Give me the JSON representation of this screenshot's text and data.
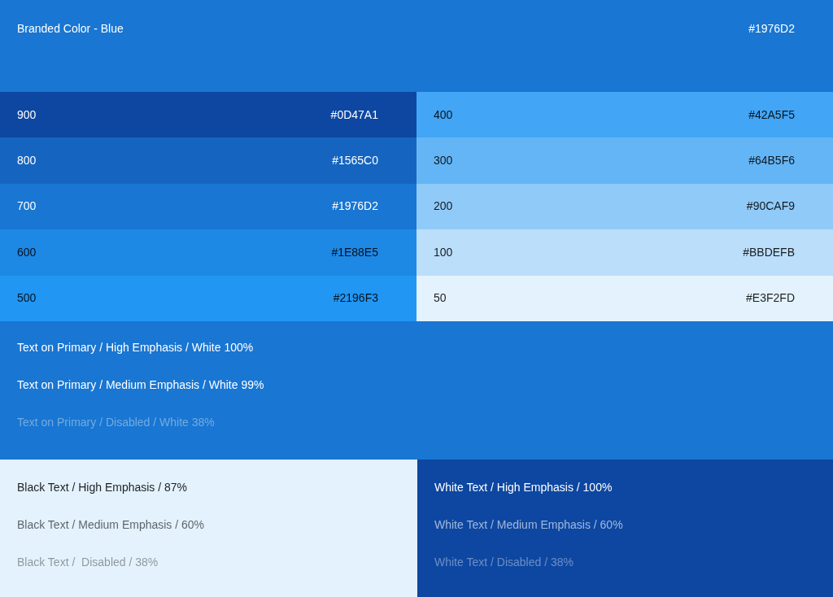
{
  "header": {
    "title": "Branded Color - Blue",
    "hex": "#1976D2",
    "color": "#1976d2"
  },
  "swatches": [
    {
      "shade": "900",
      "hex": "#0D47A1",
      "color": "#0d47a1",
      "kind": "light"
    },
    {
      "shade": "800",
      "hex": "#1565C0",
      "color": "#1565c0",
      "kind": "light"
    },
    {
      "shade": "700",
      "hex": "#1976D2",
      "color": "#1976d2",
      "kind": "light"
    },
    {
      "shade": "600",
      "hex": "#1E88E5",
      "color": "#1e88e5",
      "kind": "dark"
    },
    {
      "shade": "500",
      "hex": "#2196F3",
      "color": "#2196f3",
      "kind": "dark"
    },
    {
      "shade": "400",
      "hex": "#42A5F5",
      "color": "#42a5f5",
      "kind": "dark"
    },
    {
      "shade": "300",
      "hex": "#64B5F6",
      "color": "#64b5f6",
      "kind": "dark"
    },
    {
      "shade": "200",
      "hex": "#90CAF9",
      "color": "#90caf9",
      "kind": "dark"
    },
    {
      "shade": "100",
      "hex": "#BBDEFB",
      "color": "#bbdefb",
      "kind": "dark"
    },
    {
      "shade": "50",
      "hex": "#E3F2FD",
      "color": "#e3f2fd",
      "kind": "dark"
    }
  ],
  "primary_texts": [
    {
      "label": "Text on Primary / High Emphasis / White 100%",
      "kind": "high"
    },
    {
      "label": "Text on Primary / Medium Emphasis / White 99%",
      "kind": "high"
    },
    {
      "label": "Text on Primary / Disabled / White 38%",
      "kind": "disabled"
    }
  ],
  "black_texts": [
    {
      "label": "Black Text / High Emphasis / 87%",
      "kind": "high"
    },
    {
      "label": "Black Text / Medium Emphasis / 60%",
      "kind": "medium"
    },
    {
      "label": "Black Text /  Disabled / 38%",
      "kind": "disabled"
    }
  ],
  "white_texts": [
    {
      "label": "White Text / High Emphasis / 100%",
      "kind": "high"
    },
    {
      "label": "White Text / Medium Emphasis / 60%",
      "kind": "medium"
    },
    {
      "label": "White Text / Disabled / 38%",
      "kind": "disabled"
    }
  ]
}
